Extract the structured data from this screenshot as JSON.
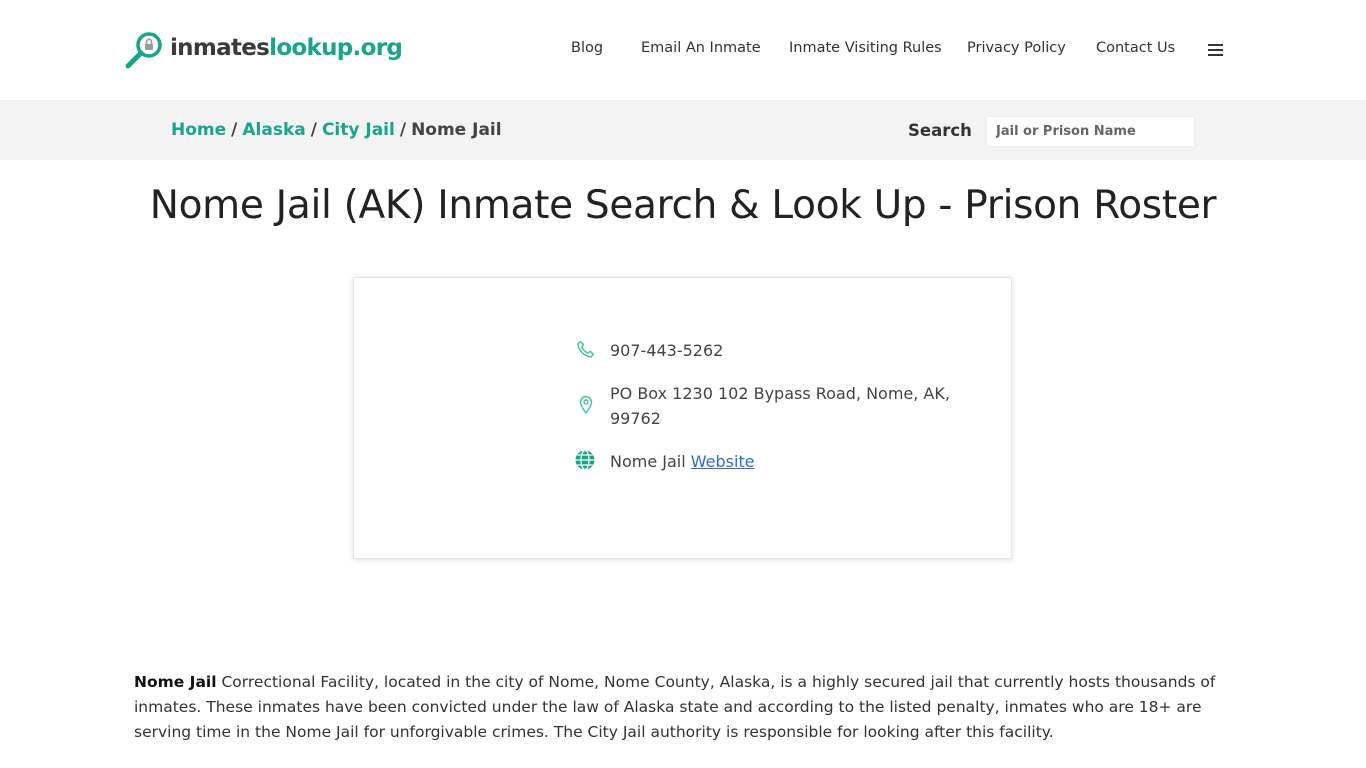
{
  "brand": {
    "name_part1": "inmates",
    "name_part2": "lookup.org",
    "logo_icon": "magnifier-lock-icon",
    "accent_color": "#17a58c"
  },
  "nav": {
    "items": [
      "Blog",
      "Email An Inmate",
      "Inmate Visiting Rules",
      "Privacy Policy",
      "Contact Us"
    ],
    "menu_icon": "hamburger-menu-icon"
  },
  "breadcrumb": {
    "items": [
      "Home",
      "Alaska",
      "City Jail"
    ],
    "separator": "/",
    "current": "Nome Jail"
  },
  "search": {
    "label": "Search",
    "placeholder": "Jail or Prison Name",
    "value": ""
  },
  "page": {
    "title": "Nome Jail (AK) Inmate Search & Look Up - Prison Roster"
  },
  "contact": {
    "phone": "907-443-5262",
    "phone_icon": "phone-icon",
    "address": "PO Box 1230 102 Bypass Road, Nome, AK, 99762",
    "address_icon": "map-pin-icon",
    "website_prefix": "Nome Jail",
    "website_link": "Website",
    "website_icon": "globe-icon"
  },
  "description": {
    "lead": "Nome Jail",
    "text": " Correctional Facility, located in the city of Nome, Nome County, Alaska, is a highly secured jail that currently hosts thousands of inmates. These inmates have been convicted under the law of Alaska state and according to the listed penalty, inmates who are 18+ are serving time in the Nome Jail for unforgivable crimes. The City Jail authority is responsible for looking after this facility."
  }
}
